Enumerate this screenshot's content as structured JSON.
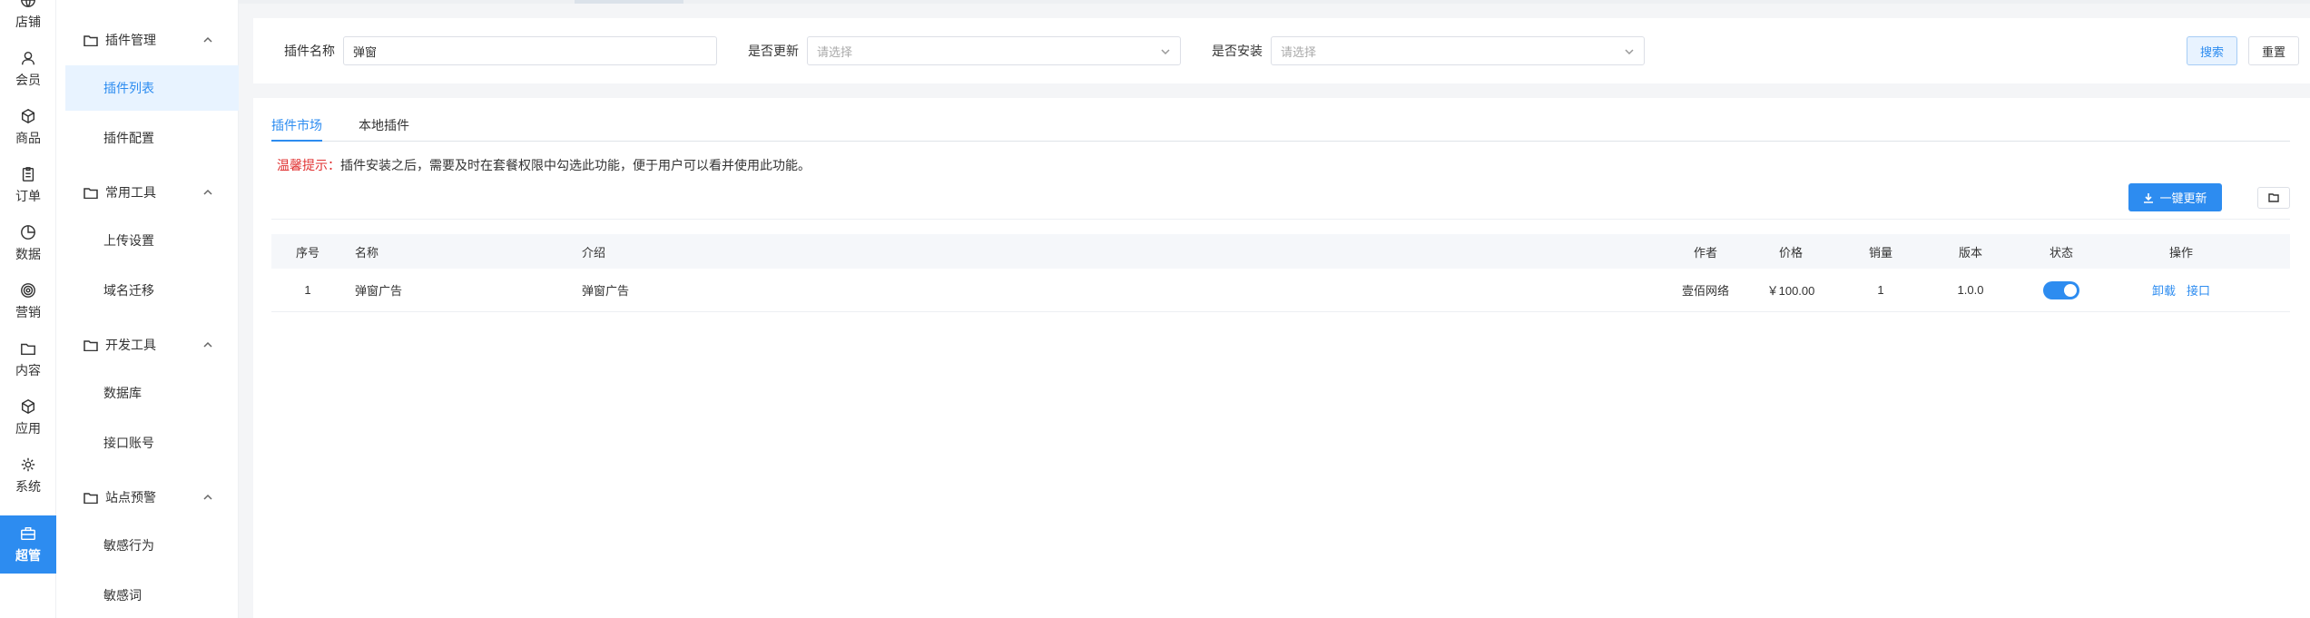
{
  "rail": {
    "items": [
      {
        "label": "店铺",
        "icon": "globe-icon"
      },
      {
        "label": "会员",
        "icon": "user-icon"
      },
      {
        "label": "商品",
        "icon": "box-icon"
      },
      {
        "label": "订单",
        "icon": "clipboard-icon"
      },
      {
        "label": "数据",
        "icon": "pie-chart-icon"
      },
      {
        "label": "营销",
        "icon": "target-icon"
      },
      {
        "label": "内容",
        "icon": "folder-icon"
      },
      {
        "label": "应用",
        "icon": "cube-icon"
      },
      {
        "label": "系统",
        "icon": "gear-icon"
      },
      {
        "label": "超管",
        "icon": "briefcase-icon"
      }
    ]
  },
  "submenu": {
    "groups": [
      {
        "title": "插件管理",
        "items": [
          "插件列表",
          "插件配置"
        ]
      },
      {
        "title": "常用工具",
        "items": [
          "上传设置",
          "域名迁移"
        ]
      },
      {
        "title": "开发工具",
        "items": [
          "数据库",
          "接口账号"
        ]
      },
      {
        "title": "站点预警",
        "items": [
          "敏感行为",
          "敏感词"
        ]
      }
    ]
  },
  "filters": {
    "name_label": "插件名称",
    "name_value": "弹窗",
    "update_label": "是否更新",
    "update_placeholder": "请选择",
    "install_label": "是否安装",
    "install_placeholder": "请选择",
    "search_label": "搜索",
    "reset_label": "重置"
  },
  "tabs": [
    "插件市场",
    "本地插件"
  ],
  "tip": {
    "prefix": "温馨提示：",
    "text": "插件安装之后，需要及时在套餐权限中勾选此功能，便于用户可以看并使用此功能。"
  },
  "actions": {
    "update_all_label": "一键更新"
  },
  "table": {
    "headers": [
      "序号",
      "名称",
      "介绍",
      "作者",
      "价格",
      "销量",
      "版本",
      "状态",
      "操作"
    ],
    "rows": [
      {
        "index": "1",
        "name": "弹窗广告",
        "intro": "弹窗广告",
        "author": "壹佰网络",
        "price": "￥100.00",
        "sales": "1",
        "version": "1.0.0",
        "status_on": true,
        "ops": [
          "卸载",
          "接口"
        ]
      }
    ]
  },
  "colors": {
    "accent": "#2d8cf0",
    "warn": "#e03131"
  }
}
